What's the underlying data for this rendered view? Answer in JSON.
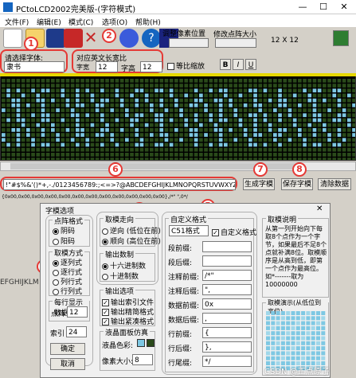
{
  "window": {
    "title": "PCtoLCD2002完美版-(字符模式)",
    "min": "—",
    "max": "☐",
    "close": "✕"
  },
  "menu": [
    "文件(F)",
    "编辑(E)",
    "模式(C)",
    "选项(O)",
    "帮助(H)"
  ],
  "toolbar": {
    "font_label": "请选择字体:",
    "font_value": "隶书",
    "size_label": "对应英文长宽比",
    "width_label": "字宽",
    "width_value": "12",
    "height_label": "字高",
    "height_value": "12",
    "scale_label": "等比缩放",
    "bold": "B",
    "italic": "I",
    "underline": "U",
    "pixel_label": "调整像素位置",
    "adjust_label": "修改点阵大小",
    "pixel_size": "12  X  12"
  },
  "annotations": [
    "1",
    "2",
    "3",
    "4",
    "5",
    "6",
    "7",
    "8"
  ],
  "chars": "!\"#$%&'()*+,-./0123456789:;<=>?@ABCDEFGHIJKLMNOPQRSTUVWXYZ[\\]^_`abcdefghijklmnopqrstuvwxyz{|}~",
  "buttons": {
    "generate": "生成字模",
    "save": "保存字模",
    "clear": "清除数据"
  },
  "small_text": "{0x00,0x00,0x00,0x00,0x00,0x00,0x00,0x00,0x00,0x00,0x00,0x00},/*\" \",0*/",
  "left_text": "EFGHIJKLM",
  "dialog": {
    "title": "字模选项",
    "close": "✕",
    "dot_format": {
      "label": "点阵格式",
      "options": [
        "阴码",
        "阳码"
      ],
      "selected": 0
    },
    "scan_mode": {
      "label": "取模方式",
      "options": [
        "逐列式",
        "逐行式",
        "列行式",
        "行列式"
      ],
      "selected": 0
    },
    "per_line": {
      "label": "每行显示数据",
      "dot_label": "点阵",
      "dot_value": "12",
      "index_label": "索引",
      "index_value": "24"
    },
    "direction": {
      "label": "取模走向",
      "options": [
        "逆向 (低位在前)",
        "顺向 (高位在前)"
      ],
      "selected": 1
    },
    "number_system": {
      "label": "输出数制",
      "options": [
        "十六进制数",
        "十进制数"
      ],
      "selected": 0
    },
    "output": {
      "label": "输出选项",
      "options": [
        "输出索引文件",
        "输出精简格式",
        "输出紧凑格式"
      ]
    },
    "lcd": {
      "label": "液晶面板仿真",
      "color_label": "液晶色彩:",
      "pixel_label": "像素大小:",
      "pixel_value": "8"
    },
    "custom": {
      "label": "自定义格式",
      "format_value": "C51格式",
      "custom_chk": "自定义格式",
      "rows": [
        {
          "label": "段前缀:",
          "value": ""
        },
        {
          "label": "段后缀:",
          "value": ""
        },
        {
          "label": "注释前缀:",
          "value": "/*\""
        },
        {
          "label": "注释后缀:",
          "value": "\","
        },
        {
          "label": "数据前缀:",
          "value": "0x"
        },
        {
          "label": "数据后缀:",
          "value": ","
        },
        {
          "label": "行前缀:",
          "value": "{"
        },
        {
          "label": "行后缀:",
          "value": "},"
        },
        {
          "label": "行尾缀:",
          "value": "*/"
        }
      ]
    },
    "explain": {
      "label": "取模说明",
      "text": "从第一列开始向下每取8个点作为一个字节，如果最后不足8个点就补满8位。取模顺序是从高到低，即第一个点作为最高位。如*-------取为10000000"
    },
    "preview_label": "取模演示(从低位到高位)",
    "ok": "确定",
    "cancel": "取消"
  },
  "watermark": "CSDN @正点原子",
  "colors": {
    "accent": "#e53935",
    "grid_bg": "#000000",
    "dot": "#7ec8e3",
    "dim": "#2a4a1a",
    "yellow": "#e6d800"
  }
}
